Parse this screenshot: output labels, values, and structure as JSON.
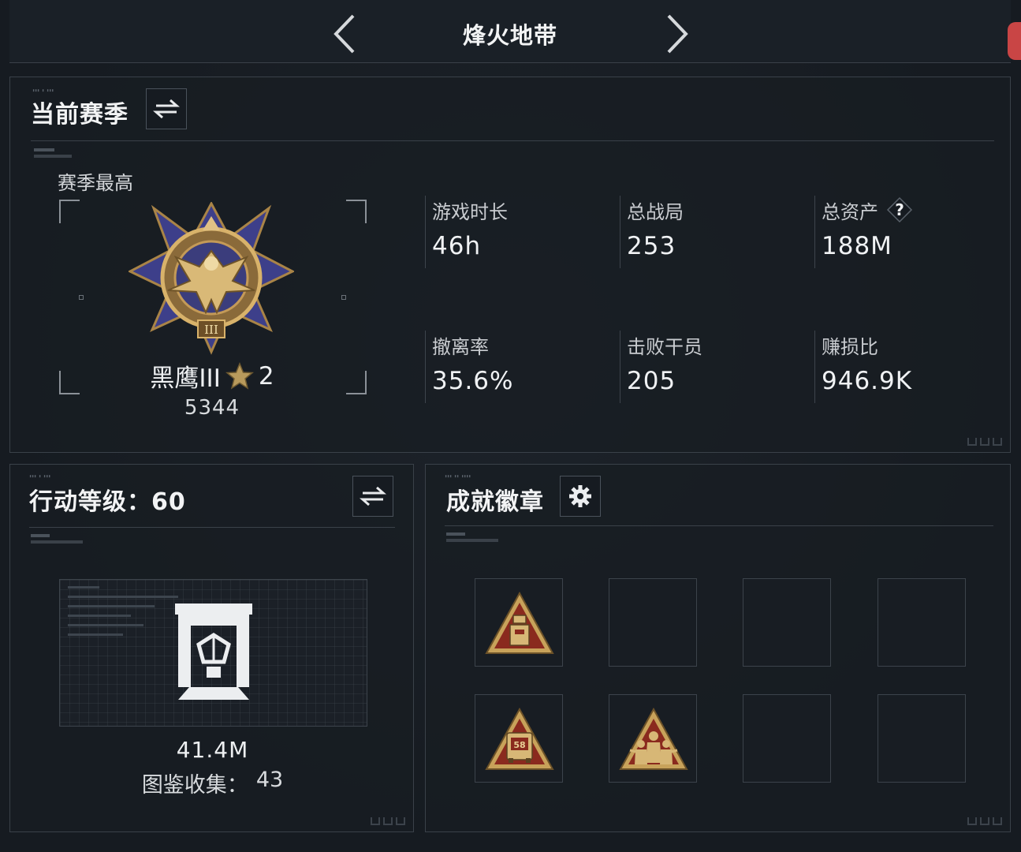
{
  "header": {
    "title": "烽火地带"
  },
  "season": {
    "title": "当前赛季",
    "best_label": "赛季最高",
    "rank_name": "黑鹰III",
    "rank_stars": "2",
    "rank_points": "5344",
    "stats": [
      {
        "label": "游戏时长",
        "value": "46h"
      },
      {
        "label": "总战局",
        "value": "253"
      },
      {
        "label": "总资产",
        "value": "188M",
        "help_icon": "?"
      },
      {
        "label": "撤离率",
        "value": "35.6%"
      },
      {
        "label": "击败干员",
        "value": "205"
      },
      {
        "label": "赚损比",
        "value": "946.9K"
      }
    ]
  },
  "level": {
    "title": "行动等级：60",
    "value": "41.4M",
    "collection_label": "图鉴收集：",
    "collection_count": "43"
  },
  "badges": {
    "title": "成就徽章",
    "slots": [
      {
        "state": "filled",
        "icon": "robot-triangle-badge"
      },
      {
        "state": "empty"
      },
      {
        "state": "empty"
      },
      {
        "state": "empty"
      },
      {
        "state": "filled",
        "icon": "truck-58-triangle-badge"
      },
      {
        "state": "filled",
        "icon": "soldiers-triangle-badge"
      },
      {
        "state": "empty"
      },
      {
        "state": "empty"
      }
    ]
  },
  "colors": {
    "background": "#161b21",
    "panel_border": "#3a4149",
    "text": "#f0f2f4",
    "badge_gold": "#c8a25a",
    "badge_red": "#8a2a1e",
    "accent_red": "#c94545"
  }
}
